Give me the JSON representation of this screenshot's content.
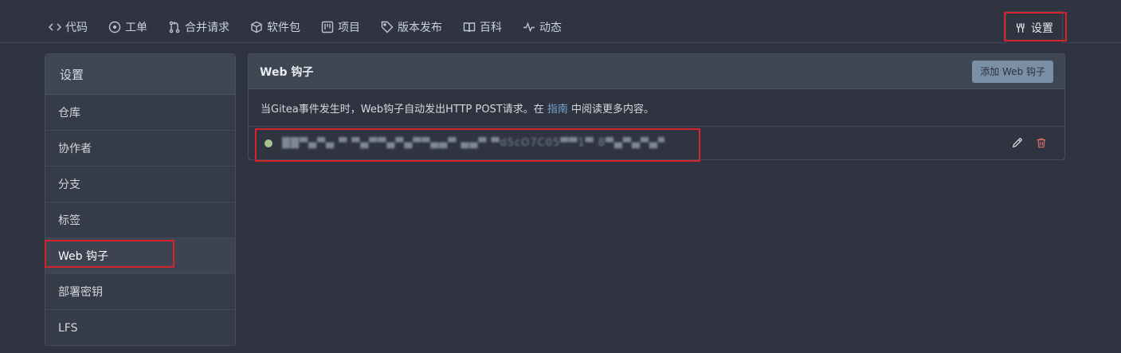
{
  "nav": {
    "tabs": [
      {
        "label": "代码",
        "icon": "code-icon"
      },
      {
        "label": "工单",
        "icon": "issue-icon"
      },
      {
        "label": "合并请求",
        "icon": "pull-request-icon"
      },
      {
        "label": "软件包",
        "icon": "package-icon"
      },
      {
        "label": "项目",
        "icon": "project-icon"
      },
      {
        "label": "版本发布",
        "icon": "tag-icon"
      },
      {
        "label": "百科",
        "icon": "book-icon"
      },
      {
        "label": "动态",
        "icon": "pulse-icon"
      }
    ],
    "settings": {
      "label": "设置",
      "icon": "tools-icon"
    }
  },
  "sidebar": {
    "header": "设置",
    "items": [
      {
        "label": "仓库"
      },
      {
        "label": "协作者"
      },
      {
        "label": "分支"
      },
      {
        "label": "标签"
      },
      {
        "label": "Web 钩子",
        "active": true
      },
      {
        "label": "部署密钥"
      },
      {
        "label": "LFS"
      }
    ]
  },
  "main": {
    "title": "Web 钩子",
    "add_button": "添加 Web 钩子",
    "description": {
      "before": "当Gitea事件发生时，Web钩子自动发出HTTP POST请求。在 ",
      "link": "指南",
      "after": " 中阅读更多内容。"
    },
    "hooks": [
      {
        "url": "██▀▄▀▄ ▀ ▀▄▀▀▄▀▄▀▀▄▄▀ ▄▄▀ ▀d5cO7C05▀▀1▀ 8▀▄▀▄▀▄▀▀▄▀▄▀▄▀▀Lv",
        "status": "active",
        "status_color": "#a6c58a"
      }
    ]
  },
  "colors": {
    "highlight": "#d4242b",
    "link": "#7aa3d1",
    "delete": "#d96c6c"
  }
}
